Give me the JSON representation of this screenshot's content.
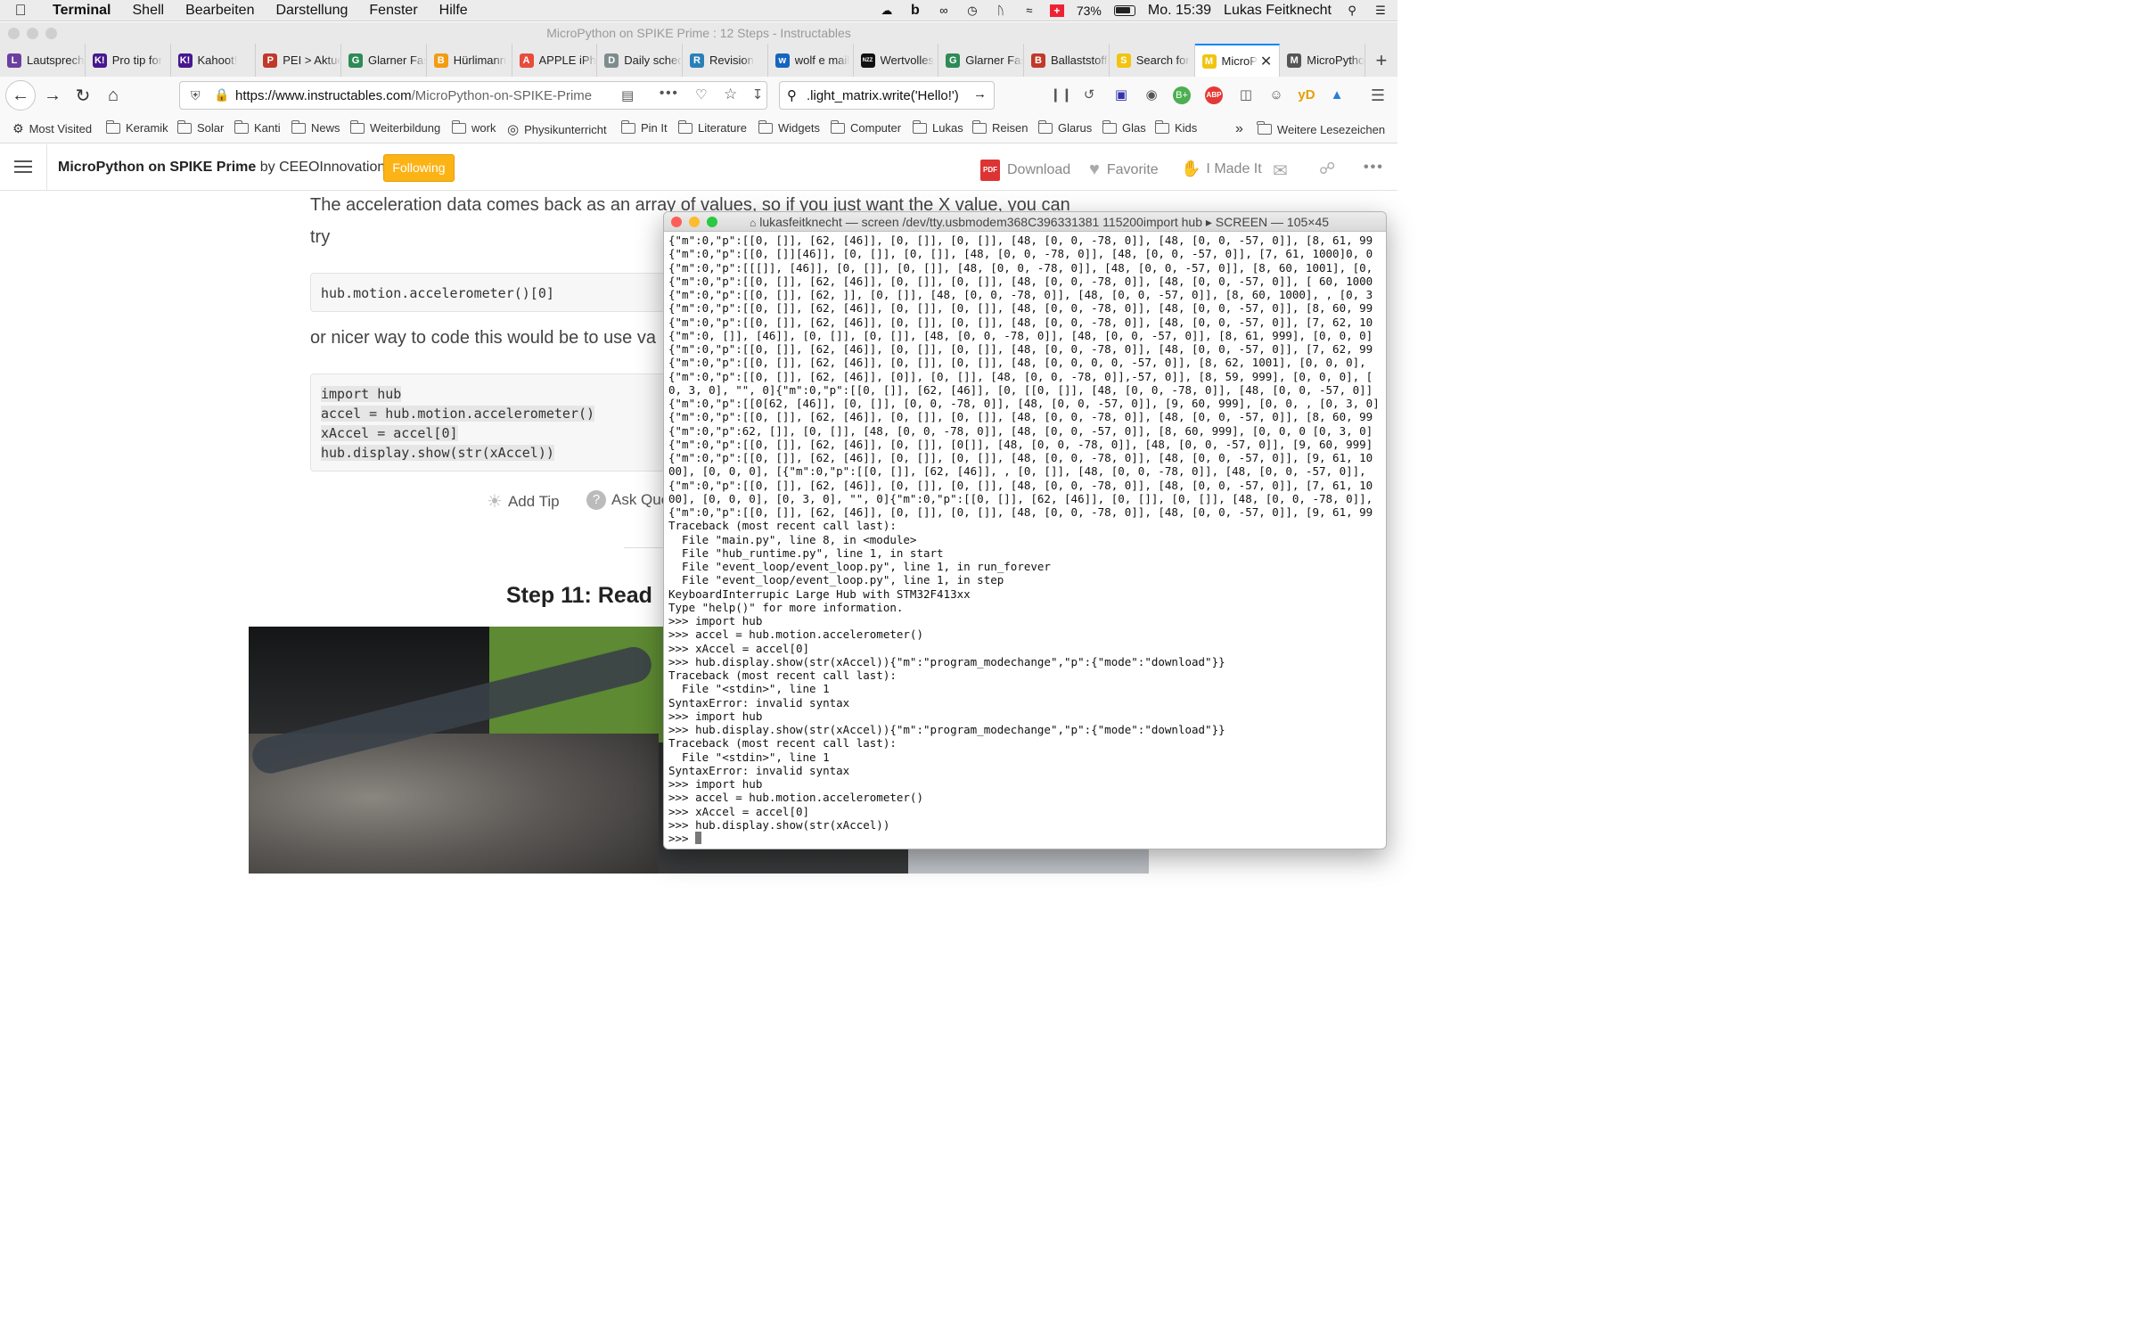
{
  "menubar": {
    "app": "Terminal",
    "items": [
      "Shell",
      "Bearbeiten",
      "Darstellung",
      "Fenster",
      "Hilfe"
    ],
    "battery": "73%",
    "clock": "Mo. 15:39",
    "user": "Lukas Feitknecht"
  },
  "window_title": "MicroPython on SPIKE Prime : 12 Steps - Instructables",
  "tabs": [
    {
      "label": "Lautsprecher",
      "icon": "L",
      "color": "#6b3fa0"
    },
    {
      "label": "Pro tip for",
      "icon": "K!",
      "color": "#46178f"
    },
    {
      "label": "Kahoot!",
      "icon": "K!",
      "color": "#46178f"
    },
    {
      "label": "PEI > Aktuell",
      "icon": "P",
      "color": "#c0392b"
    },
    {
      "label": "Glarner Fasnacht",
      "icon": "G",
      "color": "#2e8b57"
    },
    {
      "label": "Hürlimann",
      "icon": "B",
      "color": "#f39c12"
    },
    {
      "label": "APPLE iPhone",
      "icon": "A",
      "color": "#e74c3c"
    },
    {
      "label": "Daily schedule",
      "icon": "D",
      "color": "#7f8c8d"
    },
    {
      "label": "Revision",
      "icon": "R",
      "color": "#2980b9"
    },
    {
      "label": "wolf e mail",
      "icon": "w",
      "color": "#1565c0"
    },
    {
      "label": "Wertvolles",
      "icon": "NZZ",
      "color": "#111111"
    },
    {
      "label": "Glarner Fasnacht",
      "icon": "G",
      "color": "#2e8b57"
    },
    {
      "label": "Ballaststoffe",
      "icon": "B",
      "color": "#c0392b"
    },
    {
      "label": "Search for",
      "icon": "S",
      "color": "#f1c40f"
    },
    {
      "label": "MicroPython",
      "icon": "M",
      "color": "#f1c40f",
      "active": true
    },
    {
      "label": "MicroPython",
      "icon": "M",
      "color": "#555555"
    }
  ],
  "url": {
    "domain": "https://www.instructables.com",
    "path": "/MicroPython-on-SPIKE-Prime"
  },
  "search_value": ".light_matrix.write('Hello!')",
  "bookmarks": [
    "Most Visited",
    "Keramik",
    "Solar",
    "Kanti",
    "News",
    "Weiterbildung",
    "work",
    "Physikunterricht",
    "Pin It",
    "Literature",
    "Widgets",
    "Computer",
    "Lukas",
    "Reisen",
    "Glarus",
    "Glas",
    "Kids"
  ],
  "bookmarks_more": "Weitere Lesezeichen",
  "site": {
    "title": "MicroPython on SPIKE Prime",
    "by": "by CEEOInnovations",
    "follow_label": "Following",
    "download_label": "Download",
    "favorite_label": "Favorite",
    "made_label": "I Made It",
    "pdf_label": "PDF"
  },
  "article": {
    "para1_line1": "The acceleration data comes back as an array of values, so if you just want the X value, you can",
    "para1_line2": "try",
    "code1": "hub.motion.accelerometer()[0]",
    "para2": "or nicer way to code this would be to use va",
    "code2": [
      "import hub",
      "accel = hub.motion.accelerometer()",
      "xAccel = accel[0]",
      "hub.display.show(str(xAccel))"
    ],
    "add_tip": "Add Tip",
    "ask_question": "Ask Que",
    "step_heading": "Step 11: Read"
  },
  "terminal": {
    "title": "lukasfeitknecht — screen /dev/tty.usbmodem368C396331381 115200import hub ▸ SCREEN — 105×45",
    "lines": [
      "{\"m\":0,\"p\":[[0, []], [62, [46]], [0, []], [0, []], [48, [0, 0, -78, 0]], [48, [0, 0, -57, 0]], [8, 61, 99",
      "{\"m\":0,\"p\":[[0, []][46]], [0, []], [0, []], [48, [0, 0, -78, 0]], [48, [0, 0, -57, 0]], [7, 61, 1000]0, 0",
      "{\"m\":0,\"p\":[[[]], [46]], [0, []], [0, []], [48, [0, 0, -78, 0]], [48, [0, 0, -57, 0]], [8, 60, 1001], [0,",
      "{\"m\":0,\"p\":[[0, []], [62, [46]], [0, []], [0, []], [48, [0, 0, -78, 0]], [48, [0, 0, -57, 0]], [ 60, 1000",
      "{\"m\":0,\"p\":[[0, []], [62, ]], [0, []], [48, [0, 0, -78, 0]], [48, [0, 0, -57, 0]], [8, 60, 1000], , [0, 3",
      "{\"m\":0,\"p\":[[0, []], [62, [46]], [0, []], [0, []], [48, [0, 0, -78, 0]], [48, [0, 0, -57, 0]], [8, 60, 99",
      "{\"m\":0,\"p\":[[0, []], [62, [46]], [0, []], [0, []], [48, [0, 0, -78, 0]], [48, [0, 0, -57, 0]], [7, 62, 10",
      "{\"m\":0, []], [46]], [0, []], [0, []], [48, [0, 0, -78, 0]], [48, [0, 0, -57, 0]], [8, 61, 999], [0, 0, 0]",
      "{\"m\":0,\"p\":[[0, []], [62, [46]], [0, []], [0, []], [48, [0, 0, -78, 0]], [48, [0, 0, -57, 0]], [7, 62, 99",
      "{\"m\":0,\"p\":[[0, []], [62, [46]], [0, []], [0, []], [48, [0, 0, 0, 0, -57, 0]], [8, 62, 1001], [0, 0, 0],",
      "{\"m\":0,\"p\":[[0, []], [62, [46]], [0]], [0, []], [48, [0, 0, -78, 0]],-57, 0]], [8, 59, 999], [0, 0, 0], [",
      "0, 3, 0], \"\", 0]{\"m\":0,\"p\":[[0, []], [62, [46]], [0, [[0, []], [48, [0, 0, -78, 0]], [48, [0, 0, -57, 0]]",
      "{\"m\":0,\"p\":[[0[62, [46]], [0, []], [0, 0, -78, 0]], [48, [0, 0, -57, 0]], [9, 60, 999], [0, 0, , [0, 3, 0]",
      "{\"m\":0,\"p\":[[0, []], [62, [46]], [0, []], [0, []], [48, [0, 0, -78, 0]], [48, [0, 0, -57, 0]], [8, 60, 99",
      "{\"m\":0,\"p\":62, []], [0, []], [48, [0, 0, -78, 0]], [48, [0, 0, -57, 0]], [8, 60, 999], [0, 0, 0 [0, 3, 0]",
      "{\"m\":0,\"p\":[[0, []], [62, [46]], [0, []], [0[]], [48, [0, 0, -78, 0]], [48, [0, 0, -57, 0]], [9, 60, 999]",
      "{\"m\":0,\"p\":[[0, []], [62, [46]], [0, []], [0, []], [48, [0, 0, -78, 0]], [48, [0, 0, -57, 0]], [9, 61, 10",
      "00], [0, 0, 0], [{\"m\":0,\"p\":[[0, []], [62, [46]], , [0, []], [48, [0, 0, -78, 0]], [48, [0, 0, -57, 0]],",
      "{\"m\":0,\"p\":[[0, []], [62, [46]], [0, []], [0, []], [48, [0, 0, -78, 0]], [48, [0, 0, -57, 0]], [7, 61, 10",
      "00], [0, 0, 0], [0, 3, 0], \"\", 0]{\"m\":0,\"p\":[[0, []], [62, [46]], [0, []], [0, []], [48, [0, 0, -78, 0]],",
      "{\"m\":0,\"p\":[[0, []], [62, [46]], [0, []], [0, []], [48, [0, 0, -78, 0]], [48, [0, 0, -57, 0]], [9, 61, 99",
      "Traceback (most recent call last):",
      "  File \"main.py\", line 8, in <module>",
      "  File \"hub_runtime.py\", line 1, in start",
      "  File \"event_loop/event_loop.py\", line 1, in run_forever",
      "  File \"event_loop/event_loop.py\", line 1, in step",
      "KeyboardInterrupic Large Hub with STM32F413xx",
      "Type \"help()\" for more information.",
      ">>> import hub",
      ">>> accel = hub.motion.accelerometer()",
      ">>> xAccel = accel[0]",
      ">>> hub.display.show(str(xAccel)){\"m\":\"program_modechange\",\"p\":{\"mode\":\"download\"}}",
      "Traceback (most recent call last):",
      "  File \"<stdin>\", line 1",
      "SyntaxError: invalid syntax",
      ">>> import hub",
      ">>> hub.display.show(str(xAccel)){\"m\":\"program_modechange\",\"p\":{\"mode\":\"download\"}}",
      "Traceback (most recent call last):",
      "  File \"<stdin>\", line 1",
      "SyntaxError: invalid syntax",
      ">>> import hub",
      ">>> accel = hub.motion.accelerometer()",
      ">>> xAccel = accel[0]",
      ">>> hub.display.show(str(xAccel))"
    ],
    "prompt": ">>> "
  },
  "colors": {
    "accent": "#0a84ff",
    "follow": "#fcb316",
    "term_close": "#fc5f57",
    "term_min": "#fdbc2e",
    "term_max": "#29c940"
  }
}
